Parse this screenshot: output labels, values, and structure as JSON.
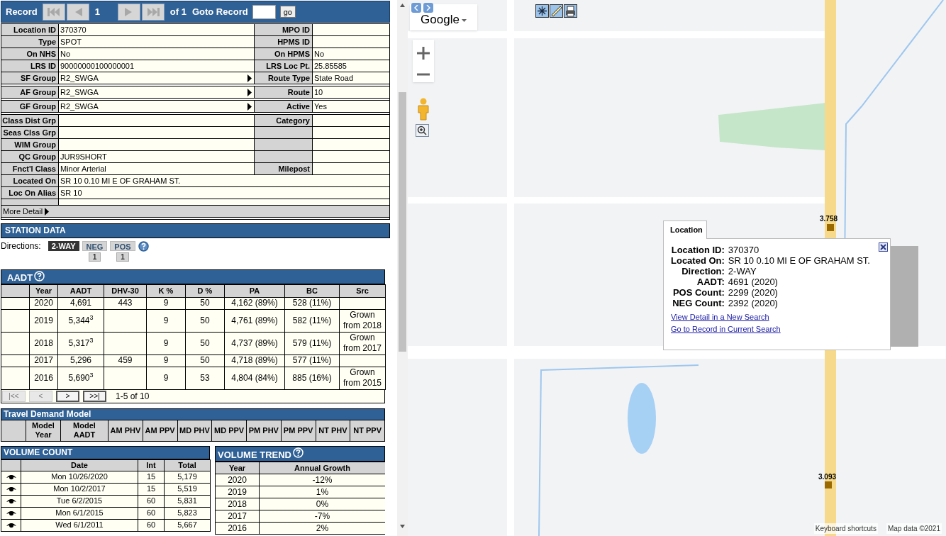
{
  "record_bar": {
    "label": "Record",
    "back_buttons": [
      {
        "kind": "first",
        "disabled": true
      },
      {
        "kind": "prev",
        "disabled": true
      }
    ],
    "current": "1",
    "forward_buttons": [
      {
        "kind": "next",
        "disabled": true
      },
      {
        "kind": "last",
        "disabled": true
      }
    ],
    "total": "of 1",
    "goto_label": "Goto Record",
    "go_button": "go"
  },
  "details": [
    {
      "kind": "pair",
      "label": "Location ID",
      "value": "370370",
      "right_label": "MPO ID"
    },
    {
      "kind": "pair",
      "label": "Type",
      "value": "SPOT",
      "right_label": "HPMS ID"
    },
    {
      "kind": "pair",
      "label": "On NHS",
      "value": "No",
      "right_label": "On HPMS",
      "right_value": "No"
    },
    {
      "kind": "pair",
      "label": "LRS ID",
      "value": "90000000100000001",
      "right_label": "LRS Loc Pt.",
      "right_value": "25.85585"
    },
    {
      "kind": "group",
      "label": "SF Group",
      "value": "R2_SWGA",
      "right_label": "Route Type",
      "right_value": "State Road"
    },
    {
      "kind": "group",
      "label": "AF Group",
      "value": "R2_SWGA",
      "right_label": "Route",
      "right_value": "10"
    },
    {
      "kind": "group",
      "label": "GF Group",
      "value": "R2_SWGA",
      "right_label": "Active",
      "right_value": "Yes"
    },
    {
      "kind": "pair",
      "label": "Class Dist Grp",
      "right_label": "Category"
    },
    {
      "kind": "pair",
      "label": "Seas Clss Grp"
    },
    {
      "kind": "pair",
      "label": "WIM Group"
    },
    {
      "kind": "pair",
      "label": "QC Group",
      "value": "JUR9SHORT"
    },
    {
      "kind": "pair",
      "label": "Fnct'l Class",
      "value": "Minor Arterial",
      "right_label": "Milepost"
    },
    {
      "kind": "wide",
      "label": "Located On",
      "value": "SR 10 0.10 MI E OF GRAHAM ST."
    },
    {
      "kind": "wide",
      "label": "Loc On Alias",
      "value": "SR 10"
    },
    {
      "kind": "blank"
    }
  ],
  "more_detail": "More Detail",
  "station_data": {
    "title": "STATION DATA",
    "directions_label": "Directions:",
    "directions": [
      {
        "label": "2-WAY",
        "selected": true
      },
      {
        "label": "NEG",
        "selected": false,
        "count": "1"
      },
      {
        "label": "POS",
        "selected": false,
        "count": "1"
      }
    ]
  },
  "aadt": {
    "title": "AADT",
    "columns": [
      "Year",
      "AADT",
      "DHV-30",
      "K %",
      "D %",
      "PA",
      "BC",
      "Src"
    ],
    "rows": [
      {
        "year": "2020",
        "aadt": "4,691",
        "dhv": "443",
        "k": "9",
        "d": "50",
        "pa": "4,162 (89%)",
        "bc": "528 (11%)"
      },
      {
        "year": "2019",
        "aadt": "5,344$^{3}$",
        "k": "9",
        "d": "50",
        "pa": "4,761 (89%)",
        "bc": "582 (11%)",
        "src": "Grown from 2018"
      },
      {
        "year": "2018",
        "aadt": "5,317$^{3}$",
        "k": "9",
        "d": "50",
        "pa": "4,737 (89%)",
        "bc": "579 (11%)",
        "src": "Grown from 2017"
      },
      {
        "year": "2017",
        "aadt": "5,296",
        "dhv": "459",
        "k": "9",
        "d": "50",
        "pa": "4,718 (89%)",
        "bc": "577 (11%)"
      },
      {
        "year": "2016",
        "aadt": "5,690$^{3}$",
        "k": "9",
        "d": "53",
        "pa": "4,804 (84%)",
        "bc": "885 (16%)",
        "src": "Grown from 2015"
      }
    ],
    "pager": [
      {
        "label": "|<<",
        "disabled": true
      },
      {
        "label": "<",
        "disabled": true
      },
      {
        "label": ">",
        "disabled": false
      },
      {
        "label": ">>|",
        "disabled": false
      }
    ],
    "range": "1-5 of 10"
  },
  "travel_demand_model": {
    "title": "Travel Demand Model",
    "columns": [
      "Model Year",
      "Model AADT",
      "AM PHV",
      "AM PPV",
      "MD PHV",
      "MD PPV",
      "PM PHV",
      "PM PPV",
      "NT PHV",
      "NT PPV"
    ]
  },
  "volume_count": {
    "title": "VOLUME COUNT",
    "columns": [
      "Date",
      "Int",
      "Total"
    ],
    "rows": [
      {
        "date": "Mon 10/26/2020",
        "int": "15",
        "total": "5,179"
      },
      {
        "date": "Mon 10/2/2017",
        "int": "15",
        "total": "5,519"
      },
      {
        "date": "Tue 6/2/2015",
        "int": "60",
        "total": "5,831"
      },
      {
        "date": "Mon 6/1/2015",
        "int": "60",
        "total": "5,823"
      },
      {
        "date": "Wed 6/1/2011",
        "int": "60",
        "total": "5,667"
      }
    ]
  },
  "volume_trend": {
    "title": "VOLUME TREND",
    "columns": [
      "Year",
      "Annual Growth"
    ],
    "rows": [
      {
        "year": "2020",
        "growth": "-12%"
      },
      {
        "year": "2019",
        "growth": "1%"
      },
      {
        "year": "2018",
        "growth": "0%"
      },
      {
        "year": "2017",
        "growth": "-7%"
      },
      {
        "year": "2016",
        "growth": "2%"
      }
    ]
  },
  "map": {
    "map_type": "Google",
    "popup": {
      "tab": "Location",
      "fields": [
        {
          "label": "Location ID:",
          "value": "370370"
        },
        {
          "label": "Located On:",
          "value": "SR 10 0.10 MI E OF GRAHAM ST."
        },
        {
          "label": "Direction:",
          "value": "2-WAY"
        },
        {
          "label": "AADT:",
          "value": "4691 (2020)"
        },
        {
          "label": "POS Count:",
          "value": "2299 (2020)"
        },
        {
          "label": "NEG Count:",
          "value": "2392 (2020)"
        }
      ],
      "links": [
        "View Detail in a New Search",
        "Go to Record in Current Search"
      ]
    },
    "markers": [
      {
        "label": "3.758"
      },
      {
        "label": "3.093"
      }
    ],
    "footer": [
      "Keyboard shortcuts",
      "Map data ©2021"
    ]
  }
}
